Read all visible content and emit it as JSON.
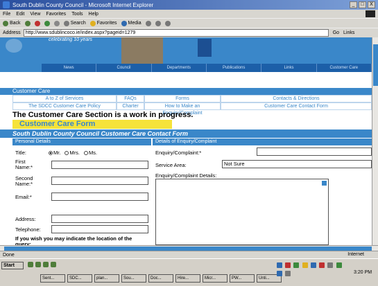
{
  "window": {
    "title": "South Dublin County Council - Microsoft Internet Explorer",
    "buttons": [
      "_",
      "□",
      "X"
    ]
  },
  "menu": [
    "File",
    "Edit",
    "View",
    "Favorites",
    "Tools",
    "Help"
  ],
  "toolbar": {
    "back": "Back",
    "search": "Search",
    "favorites": "Favorites",
    "media": "Media"
  },
  "address": {
    "label": "Address",
    "url": "http://www.sdublincoco.ie/index.aspx?pageid=1279",
    "go": "Go",
    "links": "Links"
  },
  "banner": {
    "tagline": "celebrating 10 years",
    "nav": [
      "News",
      "Council",
      "Departments",
      "Publications",
      "Links",
      "Customer Care"
    ]
  },
  "customer_care": {
    "heading": "Customer Care",
    "links": [
      "A to Z of Services",
      "FAQs",
      "Forms",
      "Contacts & Directions",
      "The SDCC Customer Care Policy",
      "Charter",
      "How to Make an Enquiry/Complaint",
      "Customer Care Contact Form"
    ],
    "wip": "The Customer Care Section is a work in progress.",
    "form_title": "Customer Care Form"
  },
  "contact_form": {
    "heading": "South Dublin County Council Customer Care Contact Form",
    "personal_heading": "Personal Details",
    "enquiry_heading": "Details of Enquiry/Complaint",
    "title_label": "Title:",
    "title_options": [
      "Mr.",
      "Mrs.",
      "Ms."
    ],
    "first_name_label": "First Name:*",
    "second_name_label": "Second Name:*",
    "email_label": "Email:*",
    "address_label": "Address:",
    "telephone_label": "Telephone:",
    "location_label": "If you wish you may indicate the location of the query:",
    "enquiry_label": "Enquiry/Complaint:*",
    "service_area_label": "Service Area:",
    "service_area_value": "Not Sure",
    "details_label": "Enquiry/Complaint Details:"
  },
  "status": {
    "text": "Done",
    "zone": "Internet"
  },
  "taskbar": {
    "start": "Start",
    "tasks": [
      "Sent...",
      "SDC...",
      "plan...",
      "Sou...",
      "Doc...",
      "Hire...",
      "Micr...",
      "PW...",
      "Unti..."
    ],
    "clock": "3:20 PM"
  }
}
